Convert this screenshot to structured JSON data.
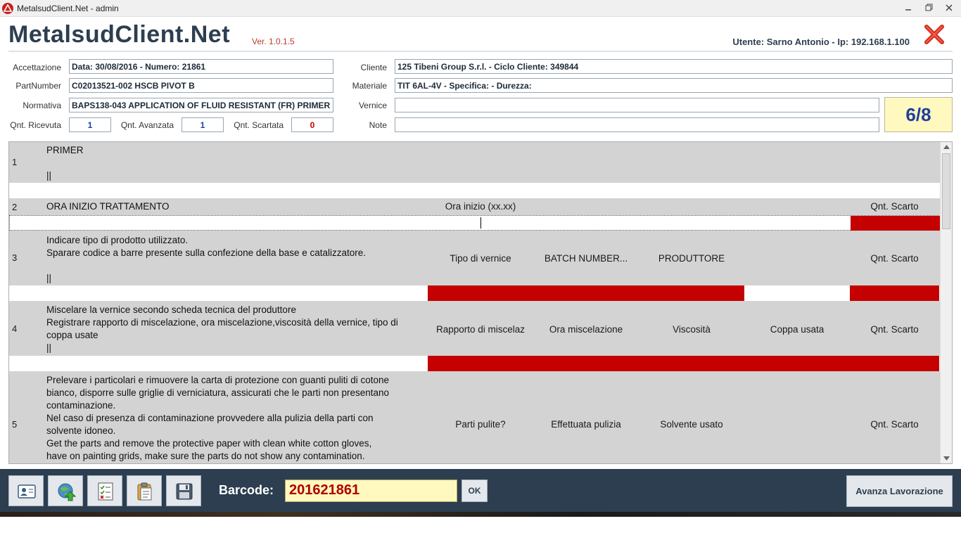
{
  "window": {
    "title": "MetalsudClient.Net - admin",
    "controls": [
      "minimize",
      "restore",
      "close"
    ]
  },
  "header": {
    "app_title": "MetalsudClient.Net",
    "version": "Ver. 1.0.1.5",
    "user_info": "Utente: Sarno Antonio - Ip: 192.168.1.100"
  },
  "form": {
    "accettazione": {
      "label": "Accettazione",
      "value": "Data: 30/08/2016 - Numero: 21861"
    },
    "partnumber": {
      "label": "PartNumber",
      "value": "C02013521-002 HSCB PIVOT B"
    },
    "normativa": {
      "label": "Normativa",
      "value": "BAPS138-043 APPLICATION OF FLUID RESISTANT (FR) PRIMER"
    },
    "cliente": {
      "label": "Cliente",
      "value": "125 Tibeni Group S.r.l.  - Ciclo Cliente: 349844"
    },
    "materiale": {
      "label": "Materiale",
      "value": "TIT 6AL-4V - Specifica:  - Durezza:"
    },
    "vernice": {
      "label": "Vernice",
      "value": ""
    },
    "note": {
      "label": "Note",
      "value": ""
    },
    "qnt_ricevuta": {
      "label": "Qnt. Ricevuta",
      "value": "1"
    },
    "qnt_avanzata": {
      "label": "Qnt. Avanzata",
      "value": "1"
    },
    "qnt_scartata": {
      "label": "Qnt. Scartata",
      "value": "0"
    },
    "step_counter": "6/8"
  },
  "steps": [
    {
      "num": "1",
      "lines": [
        "PRIMER",
        "",
        "||"
      ],
      "columns": []
    },
    {
      "num": "2",
      "lines": [
        "ORA INIZIO TRATTAMENTO"
      ],
      "columns": [
        "Ora inizio (xx.xx)",
        "Qnt. Scarto"
      ]
    },
    {
      "num": "3",
      "lines": [
        "Indicare tipo di prodotto utilizzato.",
        "Sparare codice a barre presente sulla confezione della base e catalizzatore.",
        "",
        "||"
      ],
      "columns": [
        "Tipo di vernice",
        "BATCH NUMBER...",
        "PRODUTTORE",
        "Qnt. Scarto"
      ]
    },
    {
      "num": "4",
      "lines": [
        "Miscelare la vernice secondo scheda tecnica del produttore",
        "Registrare rapporto di miscelazione,  ora miscelazione,viscosità della vernice, tipo di",
        "coppa usate",
        "||"
      ],
      "columns": [
        "Rapporto di miscelaz",
        "Ora miscelazione",
        "Viscosità",
        "Coppa usata",
        "Qnt. Scarto"
      ]
    },
    {
      "num": "5",
      "lines": [
        "Prelevare i particolari e rimuovere la carta di protezione con guanti puliti di cotone",
        "bianco, disporre sulle griglie di verniciatura, assicurati che le parti non presentano",
        "contaminazione.",
        "Nel caso di presenza di contaminazione provvedere alla pulizia della parti con",
        "solvente idoneo.",
        "Get the parts and remove the protective paper with clean white cotton gloves,",
        "have on painting grids, make sure the parts do not show any contamination."
      ],
      "columns": [
        "Parti pulite?",
        "Effettuata pulizia",
        "Solvente usato",
        "Qnt. Scarto"
      ]
    }
  ],
  "toolbar": {
    "icons": [
      "user-card-icon",
      "globe-upload-icon",
      "checklist-icon",
      "clipboard-icon",
      "save-icon"
    ],
    "barcode_label": "Barcode:",
    "barcode_value": "201621861",
    "ok_label": "OK",
    "advance_label": "Avanza Lavorazione"
  },
  "colors": {
    "header_text": "#2d3e50",
    "bottom_bar": "#2c3e50",
    "required_field": "#c40000",
    "row_bg": "#d3d3d3",
    "highlight_yellow": "#fff8bf"
  }
}
